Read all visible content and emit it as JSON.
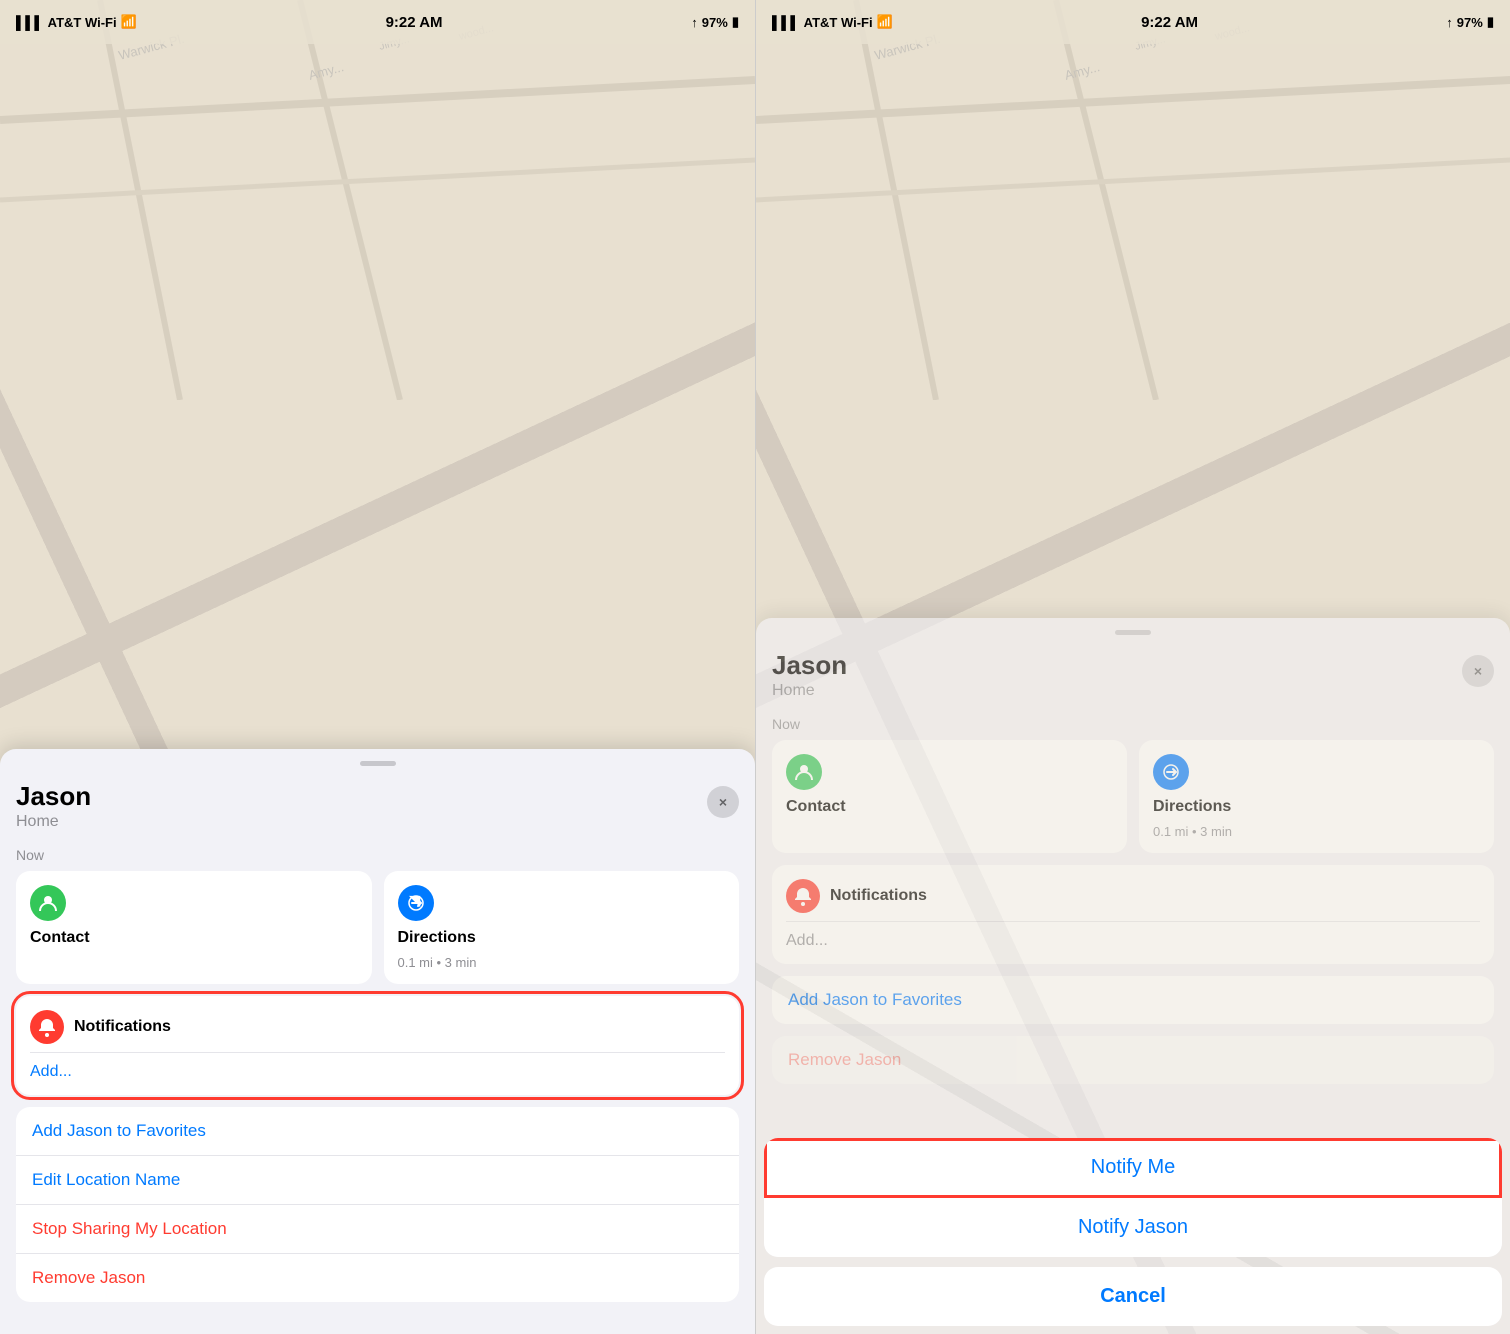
{
  "status_bar": {
    "carrier": "AT&T Wi-Fi",
    "time": "9:22 AM",
    "battery": "97%"
  },
  "left_panel": {
    "sheet": {
      "person_name": "Jason",
      "location": "Home",
      "time_label": "Now",
      "close_label": "×",
      "contact_label": "Contact",
      "directions_label": "Directions",
      "directions_sub": "0.1 mi • 3 min",
      "notifications_label": "Notifications",
      "add_label": "Add...",
      "add_favorites": "Add Jason to Favorites",
      "edit_location": "Edit Location Name",
      "stop_sharing": "Stop Sharing My Location",
      "remove": "Remove Jason"
    }
  },
  "right_panel": {
    "sheet": {
      "person_name": "Jason",
      "location": "Home",
      "time_label": "Now",
      "close_label": "×",
      "contact_label": "Contact",
      "directions_label": "Directions",
      "directions_sub": "0.1 mi • 3 min",
      "notifications_label": "Notifications",
      "add_label": "Add...",
      "add_favorites": "Add Jason to Favorites",
      "remove": "Remove Jason"
    },
    "action_sheet": {
      "notify_me": "Notify Me",
      "notify_jason": "Notify Jason",
      "cancel": "Cancel"
    }
  },
  "icons": {
    "contact": "👤",
    "directions": "➤",
    "notifications": "🔔",
    "close": "✕"
  }
}
